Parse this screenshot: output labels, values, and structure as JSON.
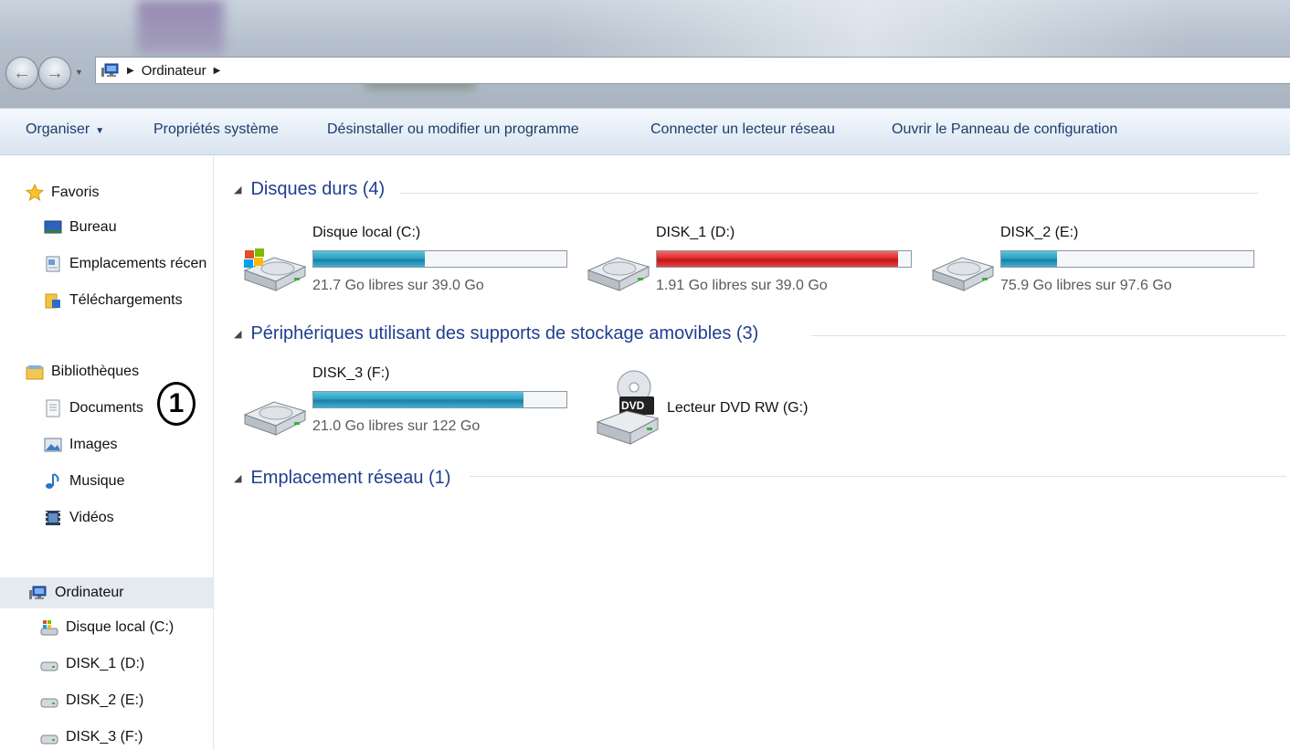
{
  "address": {
    "location": "Ordinateur"
  },
  "toolbar": {
    "organize": "Organiser",
    "system_properties": "Propriétés système",
    "uninstall": "Désinstaller ou modifier un programme",
    "map_drive": "Connecter un lecteur réseau",
    "control_panel": "Ouvrir le Panneau de configuration"
  },
  "sidebar": {
    "favorites": {
      "label": "Favoris",
      "items": [
        "Bureau",
        "Emplacements récen",
        "Téléchargements"
      ]
    },
    "libraries": {
      "label": "Bibliothèques",
      "items": [
        "Documents",
        "Images",
        "Musique",
        "Vidéos"
      ]
    },
    "computer": {
      "label": "Ordinateur",
      "items": [
        "Disque local (C:)",
        "DISK_1 (D:)",
        "DISK_2 (E:)",
        "DISK_3 (F:)"
      ]
    },
    "callout": "1"
  },
  "groups": {
    "hard_disks": "Disques durs (4)",
    "removable": "Périphériques utilisant des supports de stockage amovibles (3)",
    "network": "Emplacement réseau (1)"
  },
  "drives": {
    "c": {
      "name": "Disque local (C:)",
      "free": "21.7 Go libres sur 39.0 Go",
      "used_fraction": 0.44,
      "color": "#2aa1c4"
    },
    "d": {
      "name": "DISK_1 (D:)",
      "free": "1.91 Go libres sur 39.0 Go",
      "used_fraction": 0.95,
      "color": "#de2b2b"
    },
    "e": {
      "name": "DISK_2 (E:)",
      "free": "75.9 Go libres sur 97.6 Go",
      "used_fraction": 0.22,
      "color": "#2aa1c4"
    },
    "f": {
      "name": "DISK_3 (F:)",
      "free": "21.0 Go libres sur 122 Go",
      "used_fraction": 0.83,
      "color": "#2aa1c4"
    },
    "g": {
      "name": "Lecteur DVD RW (G:)",
      "badge": "DVD"
    }
  },
  "icons": {
    "back": "back-arrow-icon",
    "forward": "forward-arrow-icon",
    "computer": "computer-icon",
    "star": "star-icon",
    "desktop": "desktop-icon",
    "recent": "recent-places-icon",
    "downloads": "downloads-icon",
    "library": "library-icon",
    "document": "document-icon",
    "picture": "picture-icon",
    "music": "music-icon",
    "video": "video-icon",
    "hard_drive": "hard-drive-icon",
    "dvd": "dvd-drive-icon"
  }
}
